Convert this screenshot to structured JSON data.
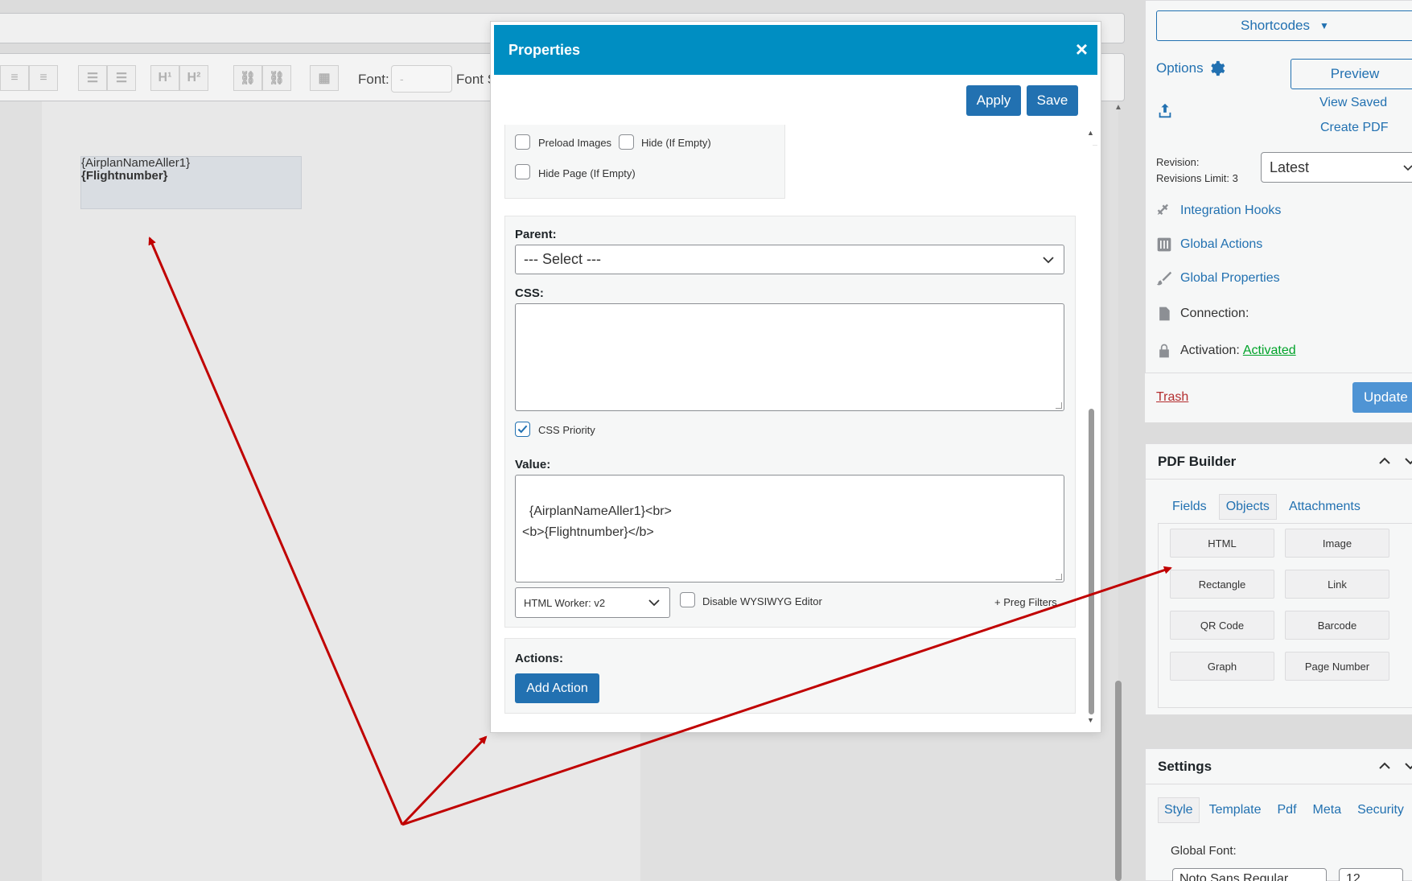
{
  "editor": {
    "font_label": "Font:",
    "font_value": "-",
    "font_size_label": "Font S",
    "canvas_object": {
      "line1": "{AirplanNameAller1}",
      "line2": "{Flightnumber}"
    }
  },
  "modal": {
    "title": "Properties",
    "close": "×",
    "apply_label": "Apply",
    "save_label": "Save",
    "options": {
      "preload_images": "Preload Images",
      "hide_if_empty": "Hide (If Empty)",
      "hide_page_if_empty": "Hide Page (If Empty)"
    },
    "parent_label": "Parent:",
    "parent_value": "--- Select ---",
    "css_label": "CSS:",
    "css_value": "",
    "css_priority_label": "CSS Priority",
    "css_priority_checked": true,
    "value_label": "Value:",
    "value_text": "{AirplanNameAller1}<br>\n<b>{Flightnumber}</b>",
    "worker_value": "HTML Worker: v2",
    "disable_wysiwyg_label": "Disable WYSIWYG Editor",
    "preg_filters_label": "+ Preg Filters",
    "actions_label": "Actions:",
    "add_action_label": "Add Action"
  },
  "sidebar": {
    "shortcodes_label": "Shortcodes",
    "options_label": "Options",
    "preview_label": "Preview",
    "view_saved_label": "View Saved",
    "create_pdf_label": "Create PDF",
    "revision_label": "Revision:",
    "revisions_limit_label": "Revisions Limit: 3",
    "revision_value": "Latest",
    "links": {
      "integration_hooks": "Integration Hooks",
      "global_actions": "Global Actions",
      "global_properties": "Global Properties",
      "connection": "Connection:",
      "activation": "Activation:",
      "activation_status": "Activated"
    },
    "trash_label": "Trash",
    "update_label": "Update",
    "pdf_builder": {
      "title": "PDF Builder",
      "tabs": [
        "Fields",
        "Objects",
        "Attachments"
      ],
      "objects": [
        "HTML",
        "Image",
        "Rectangle",
        "Link",
        "QR Code",
        "Barcode",
        "Graph",
        "Page Number"
      ]
    },
    "settings": {
      "title": "Settings",
      "tabs": [
        "Style",
        "Template",
        "Pdf",
        "Meta",
        "Security"
      ],
      "global_font_label": "Global Font:",
      "global_font_value": "Noto Sans Regular",
      "font_size_value": "12"
    }
  },
  "colors": {
    "header_blue": "#008ec2",
    "button_blue": "#2271b1",
    "link_blue": "#2271b1",
    "activated_green": "#00a32a",
    "trash_red": "#b32d2e",
    "annotation_arrow": "#c00000"
  }
}
